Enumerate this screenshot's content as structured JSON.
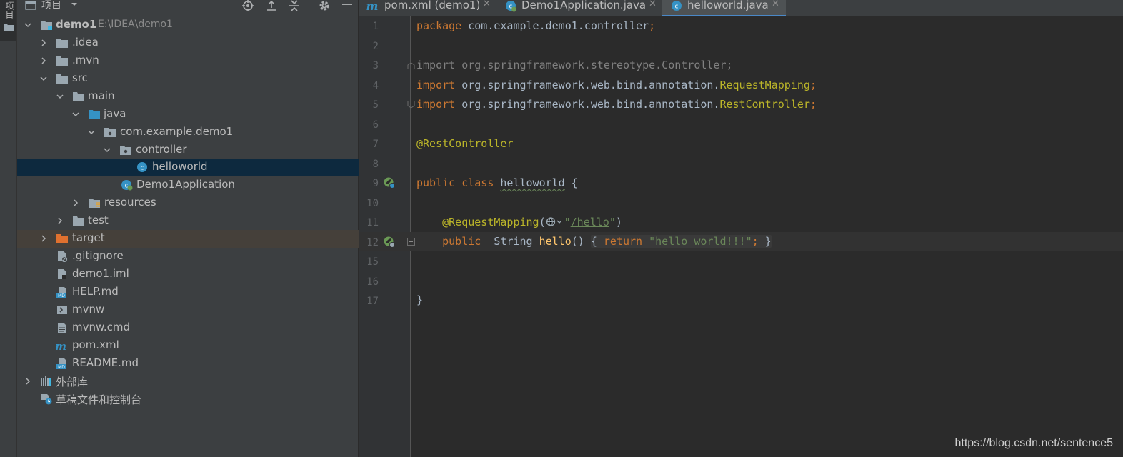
{
  "left_stripe": {
    "tab_label": "项目"
  },
  "project_panel": {
    "title": "项目",
    "tree": [
      {
        "label": "demo1",
        "path": "E:\\IDEA\\demo1",
        "icon": "module-folder-icon"
      },
      {
        "label": ".idea",
        "icon": "folder-icon"
      },
      {
        "label": ".mvn",
        "icon": "folder-icon"
      },
      {
        "label": "src",
        "icon": "folder-icon"
      },
      {
        "label": "main",
        "icon": "folder-icon"
      },
      {
        "label": "java",
        "icon": "source-folder-icon"
      },
      {
        "label": "com.example.demo1",
        "icon": "package-icon"
      },
      {
        "label": "controller",
        "icon": "package-icon"
      },
      {
        "label": "helloworld",
        "icon": "class-icon"
      },
      {
        "label": "Demo1Application",
        "icon": "spring-class-icon"
      },
      {
        "label": "resources",
        "icon": "resources-folder-icon"
      },
      {
        "label": "test",
        "icon": "folder-icon"
      },
      {
        "label": "target",
        "icon": "excluded-folder-icon"
      },
      {
        "label": ".gitignore",
        "icon": "ignored-file-icon"
      },
      {
        "label": "demo1.iml",
        "icon": "iml-file-icon"
      },
      {
        "label": "HELP.md",
        "icon": "markdown-file-icon"
      },
      {
        "label": "mvnw",
        "icon": "shell-script-icon"
      },
      {
        "label": "mvnw.cmd",
        "icon": "text-file-icon"
      },
      {
        "label": "pom.xml",
        "icon": "maven-icon"
      },
      {
        "label": "README.md",
        "icon": "markdown-file-icon"
      },
      {
        "label": "外部库",
        "icon": "library-icon"
      },
      {
        "label": "草稿文件和控制台",
        "icon": "scratch-icon"
      }
    ]
  },
  "tabs": [
    {
      "label": "pom.xml (demo1)",
      "icon": "maven-icon"
    },
    {
      "label": "Demo1Application.java",
      "icon": "spring-class-icon"
    },
    {
      "label": "helloworld.java",
      "icon": "class-icon"
    }
  ],
  "editor": {
    "line_numbers": [
      "1",
      "2",
      "3",
      "4",
      "5",
      "6",
      "7",
      "8",
      "9",
      "10",
      "11",
      "12",
      "15",
      "16",
      "17"
    ],
    "code": {
      "l1_kw": "package",
      "l1_rest": " com.example.demo1.controller",
      "l1_semi": ";",
      "l3": "import org.springframework.stereotype.Controller;",
      "l4_kw": "import",
      "l4_pkg": " org.springframework.web.bind.annotation.",
      "l4_cls": "RequestMapping",
      "l4_semi": ";",
      "l5_kw": "import",
      "l5_pkg": " org.springframework.web.bind.annotation.",
      "l5_cls": "RestController",
      "l5_semi": ";",
      "l7": "@RestController",
      "l9_kw": "public class",
      "l9_name": "helloworld",
      "l9_brace": " {",
      "l11_ann": "@RequestMapping",
      "l11_open": "(",
      "l11_quote1": "\"",
      "l11_path": "/hello",
      "l11_quote2": "\"",
      "l11_close": ")",
      "l12_kw": "public",
      "l12_type": "String",
      "l12_fn": "hello",
      "l12_parens": "()",
      "l12_body_open": "{ ",
      "l12_ret": "return",
      "l12_str": "\"hello world!!!\"",
      "l12_semi": ";",
      "l12_body_close": " }",
      "l17": "}"
    }
  },
  "watermark": "https://blog.csdn.net/sentence5",
  "colors": {
    "accent": "#4a88c7",
    "keyword": "#cc7832",
    "annotation": "#bbb529",
    "string": "#6a8759",
    "function": "#ffc66d",
    "text": "#a9b7c6"
  }
}
